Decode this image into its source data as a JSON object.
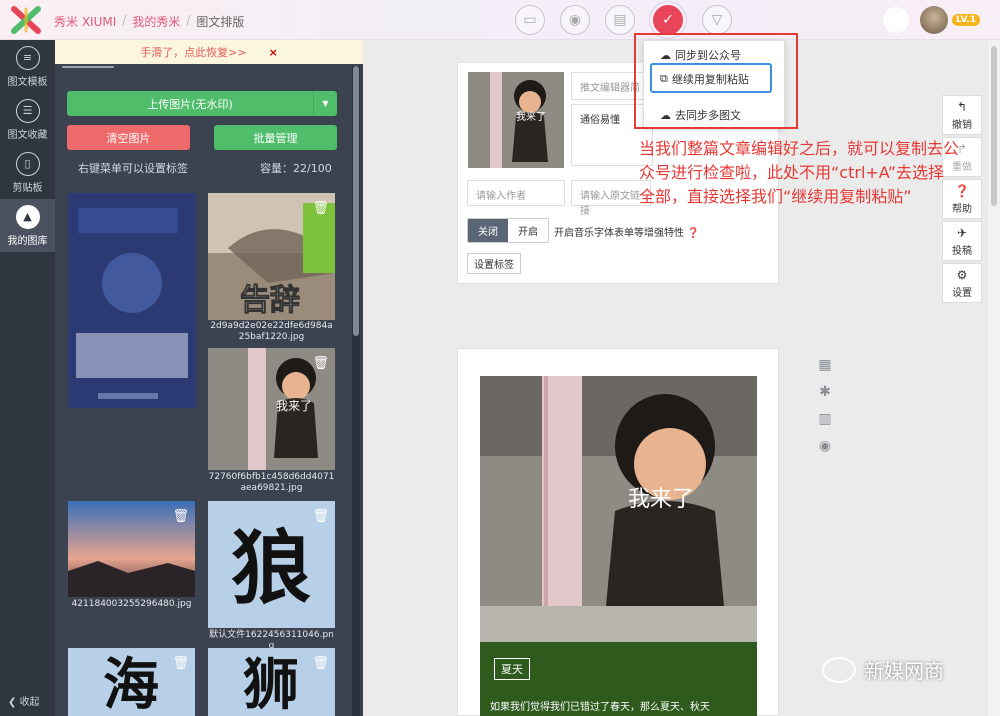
{
  "header": {
    "breadcrumb": [
      "秀米 XIUMI",
      "我的秀米",
      "图文排版"
    ],
    "level_badge": "LV.1",
    "tools": [
      "folder-icon",
      "camera-icon",
      "printer-icon",
      "check-icon",
      "triangle-down-icon"
    ]
  },
  "leftnav": {
    "items": [
      {
        "label": "图文模板",
        "icon": "list-icon"
      },
      {
        "label": "图文收藏",
        "icon": "star-list-icon"
      },
      {
        "label": "剪贴板",
        "icon": "clipboard-icon"
      },
      {
        "label": "我的图库",
        "icon": "image-library-icon"
      }
    ],
    "collapse": "收起"
  },
  "panel": {
    "undo_text": "手滑了，点此恢复>>",
    "undo_close": "×",
    "upload": "上传图片(无水印)",
    "clear": "清空图片",
    "batch": "批量管理",
    "hint": "右键菜单可以设置标签",
    "capacity": "容量：22/100",
    "images": [
      {
        "caption": "",
        "text": ""
      },
      {
        "caption": "2d9a9d2e02e22dfe6d984a25baf1220.jpg",
        "text": "告辞"
      },
      {
        "caption": "72760f6bfb1c458d6dd4071aea69821.jpg",
        "text": "我来了"
      },
      {
        "caption": "421184003255296480.jpg",
        "text": ""
      },
      {
        "caption": "默认文件1622456311046.png",
        "text": "狼"
      },
      {
        "caption": "",
        "text": "海"
      },
      {
        "caption": "",
        "text": "狮"
      }
    ]
  },
  "editor": {
    "summary_placeholder": "推文编辑器简",
    "summary_text": "通俗易懂",
    "author_placeholder": "请输入作者",
    "url_placeholder": "请输入原文链接",
    "toggle_off": "关闭",
    "toggle_on": "开启",
    "music_label": "开启音乐字体表单等增强特性",
    "set_tag": "设置标签",
    "photo_text": "我来了",
    "article_tag": "夏天",
    "article_text": "如果我们觉得我们已错过了春天，那么夏天、秋天"
  },
  "dropdown": {
    "items": [
      "同步到公众号",
      "继续用复制粘贴",
      "去同步多图文"
    ]
  },
  "right_tools": [
    {
      "label": "撤销",
      "icon": "undo-icon"
    },
    {
      "label": "重做",
      "icon": "redo-icon"
    },
    {
      "label": "帮助",
      "icon": "help-icon"
    },
    {
      "label": "投稿",
      "icon": "submit-icon"
    },
    {
      "label": "设置",
      "icon": "settings-icon"
    }
  ],
  "annotation": "当我们整篇文章编辑好之后，就可以复制去公众号进行检查啦，此处不用“ctrl+A”去选择全部，直接选择我们“继续用复制粘贴”",
  "watermark": "新媒网商",
  "colors": {
    "accent": "#e8455a",
    "green": "#4fbd6a",
    "red": "#ef6b6b",
    "nav": "#2f3640"
  }
}
